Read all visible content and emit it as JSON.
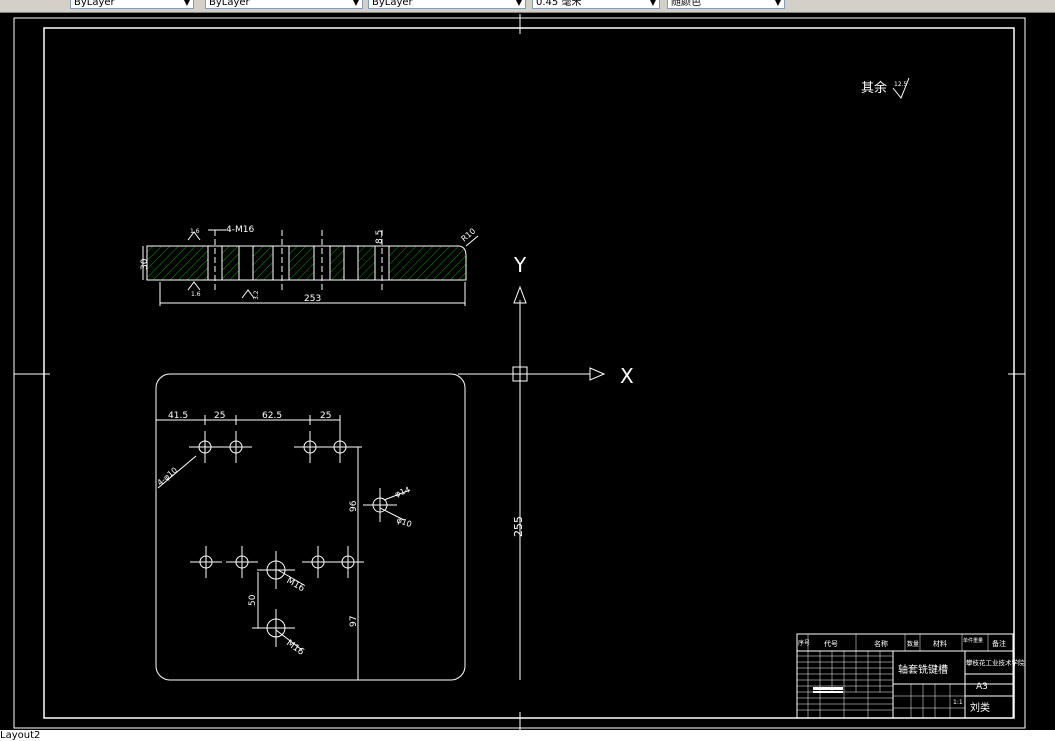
{
  "toolbar": {
    "layer_combo": "ByLayer",
    "linetype_combo": "ByLayer",
    "lineweight_combo": "0.45 毫米",
    "color_combo": "随颜色"
  },
  "drawing": {
    "surface_note": "其余",
    "surface_value": "12.5",
    "axis_x": "X",
    "axis_y": "Y",
    "dims": {
      "holes_label": "4-M16",
      "d_8_5": "8.5",
      "r10": "R10",
      "d_30": "30",
      "d_253": "253",
      "d_41_5": "41.5",
      "d_25a": "25",
      "d_62_5": "62.5",
      "d_25b": "25",
      "d_255": "255",
      "d_96": "96",
      "d_50": "50",
      "d_97": "97",
      "phi14": "φ14",
      "phi10": "φ10",
      "m16a": "M16",
      "m16b": "M16",
      "four_phi": "4-φ10",
      "rough_16a": "1.6",
      "rough_16b": "1.6",
      "rough_32": "3.2"
    },
    "title_block": {
      "part_name": "轴套铣键槽",
      "school": "攀枝花工业技术学院",
      "size": "A3",
      "author": "刘类",
      "hdr_seq": "序号",
      "hdr_code": "代号",
      "hdr_name": "名称",
      "hdr_qty": "数量",
      "hdr_mat": "材料",
      "hdr_weight": "单件重量",
      "hdr_note": "备注",
      "scale": "1:1"
    }
  },
  "status": {
    "layout_tab": "Layout2"
  }
}
